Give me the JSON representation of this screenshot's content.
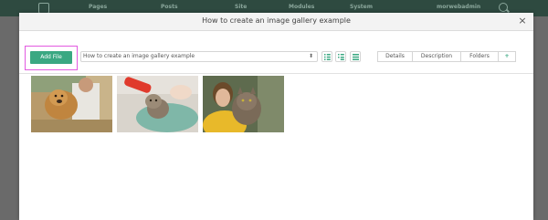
{
  "background_nav": {
    "items": [
      "Pages",
      "Posts",
      "Site",
      "Modules",
      "System",
      "morwebadmin"
    ]
  },
  "modal": {
    "title": "How to create an image gallery example",
    "close_symbol": "×"
  },
  "toolbar": {
    "add_file_label": "Add File",
    "gallery_select_value": "How to create an image gallery example",
    "tabs": [
      {
        "label": "Details"
      },
      {
        "label": "Description"
      },
      {
        "label": "Folders"
      },
      {
        "label": "+"
      }
    ]
  },
  "images": [
    {
      "name": "man-with-golden-retriever"
    },
    {
      "name": "kitten-being-bottle-fed"
    },
    {
      "name": "woman-holding-tabby-cat"
    }
  ],
  "colors": {
    "accent": "#3aa882",
    "highlight": "#e25ae0",
    "nav_bg": "#2e4a40"
  }
}
